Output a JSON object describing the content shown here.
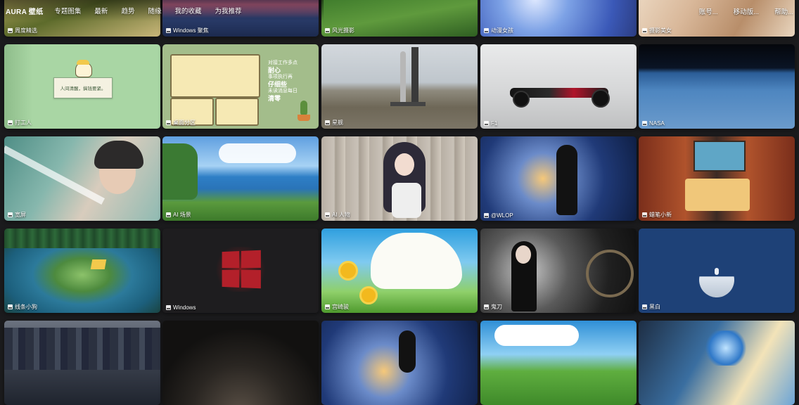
{
  "nav": {
    "brand": "AURA 壁纸",
    "items": [
      "专题图集",
      "最新",
      "趋势",
      "随缘",
      "我的收藏",
      "为我推荐"
    ],
    "right": [
      "账号...",
      "移动版...",
      "帮助..."
    ]
  },
  "tiles": [
    {
      "label": "周度精选",
      "art": "terrace"
    },
    {
      "label": "Windows 聚焦",
      "art": "lake"
    },
    {
      "label": "风光摄影",
      "art": "green-valley"
    },
    {
      "label": "动漫女孩",
      "art": "anime-blue"
    },
    {
      "label": "摄影美女",
      "art": "warm-room"
    },
    {
      "label": "打工人",
      "art": "green-note"
    },
    {
      "label": "桌面分区",
      "art": "desk-zones"
    },
    {
      "label": "星舰",
      "art": "starship"
    },
    {
      "label": "F1",
      "art": "f1"
    },
    {
      "label": "NASA",
      "art": "earth"
    },
    {
      "label": "宽屏",
      "art": "portrait-teal"
    },
    {
      "label": "AI 场景",
      "art": "coast"
    },
    {
      "label": "AI 人物",
      "art": "newspaper-girl"
    },
    {
      "label": "@WLOP",
      "art": "violin"
    },
    {
      "label": "蜡笔小新",
      "art": "shin"
    },
    {
      "label": "线条小狗",
      "art": "forest-island"
    },
    {
      "label": "Windows",
      "art": "windows"
    },
    {
      "label": "宫崎骏",
      "art": "sunflower"
    },
    {
      "label": "鬼刀",
      "art": "dark-girl"
    },
    {
      "label": "黑白",
      "art": "moon"
    },
    {
      "label": "",
      "art": "city"
    },
    {
      "label": "",
      "art": "dark-planet"
    },
    {
      "label": "",
      "art": "violin2"
    },
    {
      "label": "",
      "art": "hills"
    },
    {
      "label": "",
      "art": "glass-flower"
    }
  ],
  "green_note": {
    "text": "人间清醒，搞钱要紧。"
  },
  "desk_zone": {
    "lines": [
      "对接工作多点",
      "耐心",
      "事项执行再",
      "仔细些",
      "未读消息每日",
      "清零"
    ]
  }
}
